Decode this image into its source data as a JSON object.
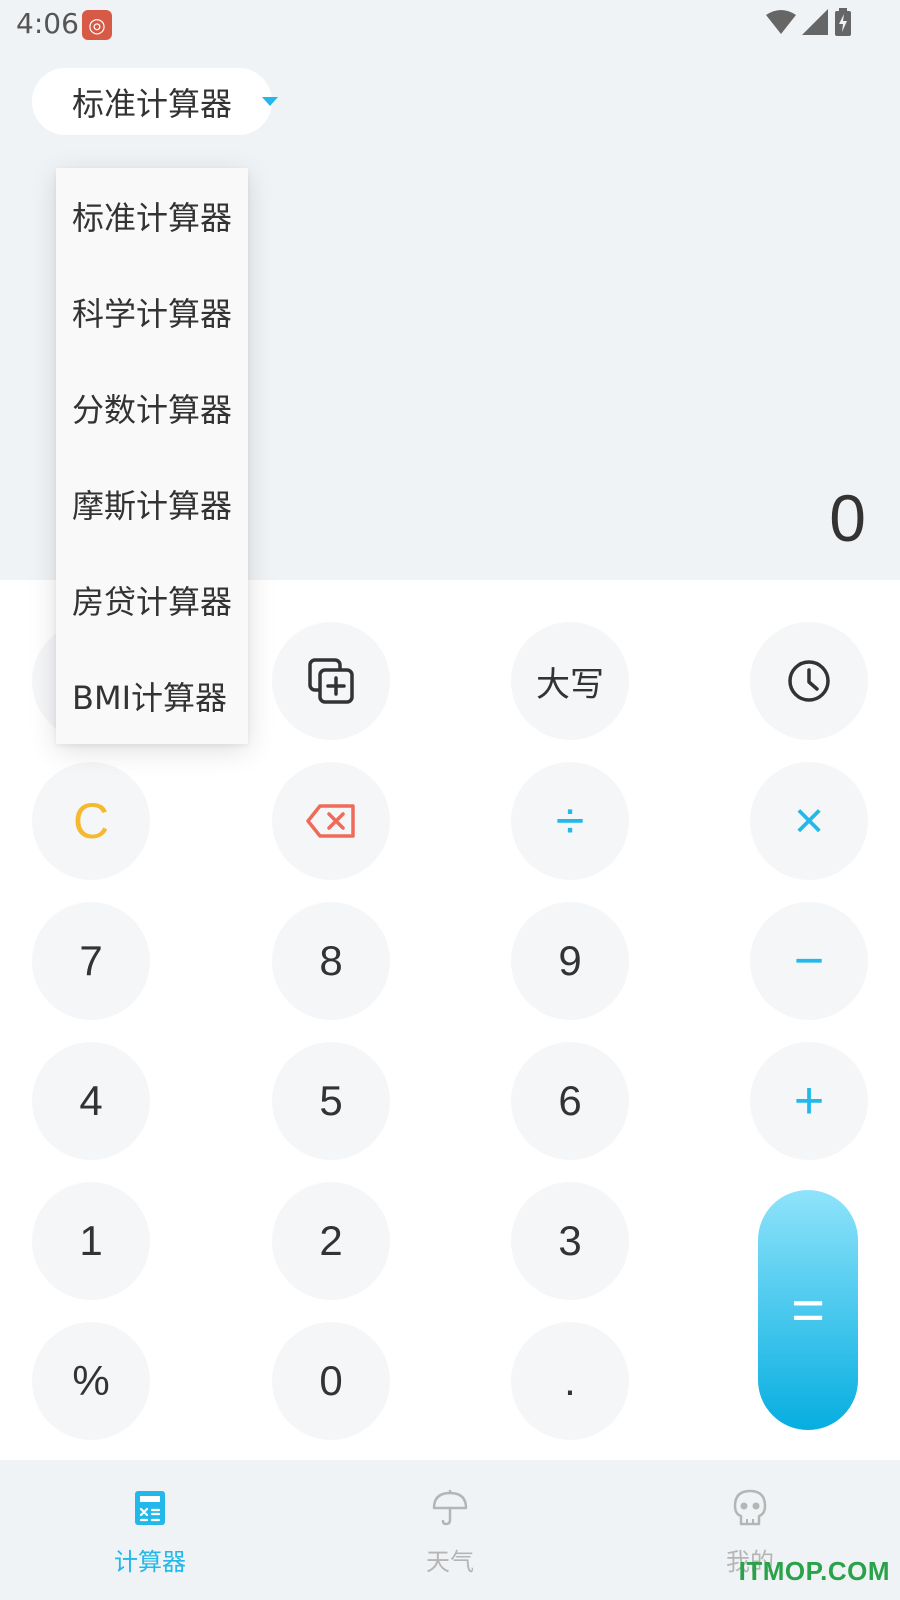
{
  "status_bar": {
    "time": "4:06",
    "app_icon": "app-notification-icon"
  },
  "mode_selector": {
    "label": "标准计算器"
  },
  "display": {
    "value": "0"
  },
  "dropdown": {
    "items": [
      "标准计算器",
      "科学计算器",
      "分数计算器",
      "摩斯计算器",
      "房贷计算器",
      "BMI计算器"
    ]
  },
  "keypad": {
    "copy_icon": "copy-add-icon",
    "uppercase": "大写",
    "history_icon": "clock-icon",
    "clear": "C",
    "backspace_icon": "backspace-icon",
    "divide": "÷",
    "multiply": "×",
    "minus": "−",
    "plus": "+",
    "equals": "=",
    "digits": {
      "d0": "0",
      "d1": "1",
      "d2": "2",
      "d3": "3",
      "d4": "4",
      "d5": "5",
      "d6": "6",
      "d7": "7",
      "d8": "8",
      "d9": "9"
    },
    "percent": "%",
    "dot": "."
  },
  "bottom_nav": {
    "items": [
      {
        "label": "计算器",
        "icon": "calculator-icon",
        "active": true
      },
      {
        "label": "天气",
        "icon": "umbrella-icon",
        "active": false
      },
      {
        "label": "我的",
        "icon": "skull-icon",
        "active": false
      }
    ]
  },
  "colors": {
    "accent": "#22b8ea",
    "clear": "#f5b82e",
    "backspace": "#f06a5a",
    "background": "#f0f3f5"
  },
  "watermark": "ITMOP.COM"
}
